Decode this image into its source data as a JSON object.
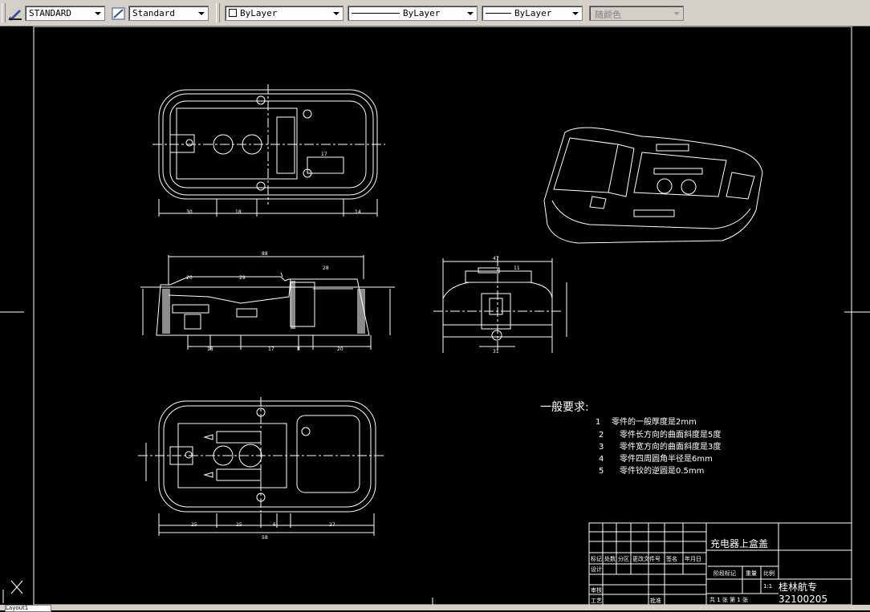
{
  "toolbar": {
    "text_style": "STANDARD",
    "dim_style": "Standard",
    "layer": "ByLayer",
    "linetype": "ByLayer",
    "lineweight": "ByLayer",
    "plot_style": "随颜色"
  },
  "drawing": {
    "notes_heading": "一般要求:",
    "notes": [
      {
        "num": "1",
        "text": "零件的一般厚度是2mm"
      },
      {
        "num": "2",
        "text": "零件长方向的曲面斜度是5度"
      },
      {
        "num": "3",
        "text": "零件宽方向的曲面斜度是3度"
      },
      {
        "num": "4",
        "text": "零件四周圆角半径是6mm"
      },
      {
        "num": "5",
        "text": "零件铰的逆圆是0.5mm"
      }
    ],
    "title_block": {
      "part_name": "充电器上盒盖",
      "school": "桂林航专",
      "drawing_no": "32100205",
      "cols": [
        "标记",
        "处数",
        "分区",
        "更改文件号",
        "签名",
        "年月日"
      ],
      "design": "设计",
      "review": "审核",
      "process": "工艺",
      "approve": "批准",
      "stage": "阶段标记",
      "weight": "重量",
      "scale": "比例",
      "scale_val": "1:1",
      "sheets": "共 1 张  第 1 张"
    },
    "dims_top": [
      "30",
      "18",
      "14",
      "17"
    ],
    "dims_mid": [
      "88",
      "28",
      "20",
      "29",
      "18",
      "17",
      "8",
      "20"
    ],
    "dims_side": [
      "47",
      "31",
      "11"
    ],
    "dims_bottom": [
      "25",
      "25",
      "6",
      "27",
      "58"
    ]
  },
  "layout_tab": "Layout1"
}
